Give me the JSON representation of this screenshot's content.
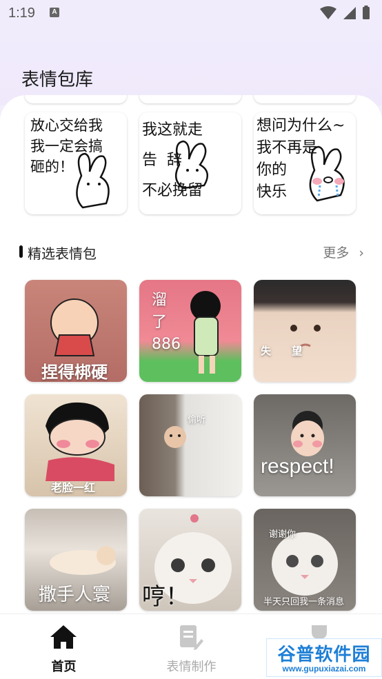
{
  "status_bar": {
    "time": "1:19",
    "notification_icon": "A"
  },
  "page_title": "表情包库",
  "sketch_row": [
    {
      "text": "放心交给我\n我一定会搞\n砸的！"
    },
    {
      "text": "我这就走\n告  辞\n不必挽留"
    },
    {
      "text": "想问为什么~\n我不再是\n你的\n快乐"
    }
  ],
  "section": {
    "title": "精选表情包",
    "more": "更多",
    "more_icon": "chevron-right-icon"
  },
  "stickers": [
    {
      "caption": "捏得梆硬",
      "color": "#c98a7a"
    },
    {
      "caption": "溜\n了\n886",
      "color": "#e07a88"
    },
    {
      "caption": "失　　望",
      "color": "#b9a79c"
    },
    {
      "caption": "老脸一红",
      "color": "#c9b6a0"
    },
    {
      "caption": "偷听",
      "color": "#9a9a9a"
    },
    {
      "caption": "respect!",
      "color": "#8d8a86"
    },
    {
      "caption": "撒手人寰",
      "color": "#a8a29b"
    },
    {
      "caption": "哼！",
      "color": "#d8cfc4"
    },
    {
      "caption_top": "谢谢你",
      "caption": "半天只回我一条消息",
      "color": "#7f7b76"
    }
  ],
  "tabs": [
    {
      "label": "首页",
      "icon": "home-icon",
      "active": true
    },
    {
      "label": "表情制作",
      "icon": "edit-document-icon",
      "active": false
    },
    {
      "label": "",
      "icon": "mine-icon",
      "active": false
    }
  ],
  "watermark": {
    "top": "谷普软件园",
    "bottom": "www.gupuxiazai.com"
  }
}
